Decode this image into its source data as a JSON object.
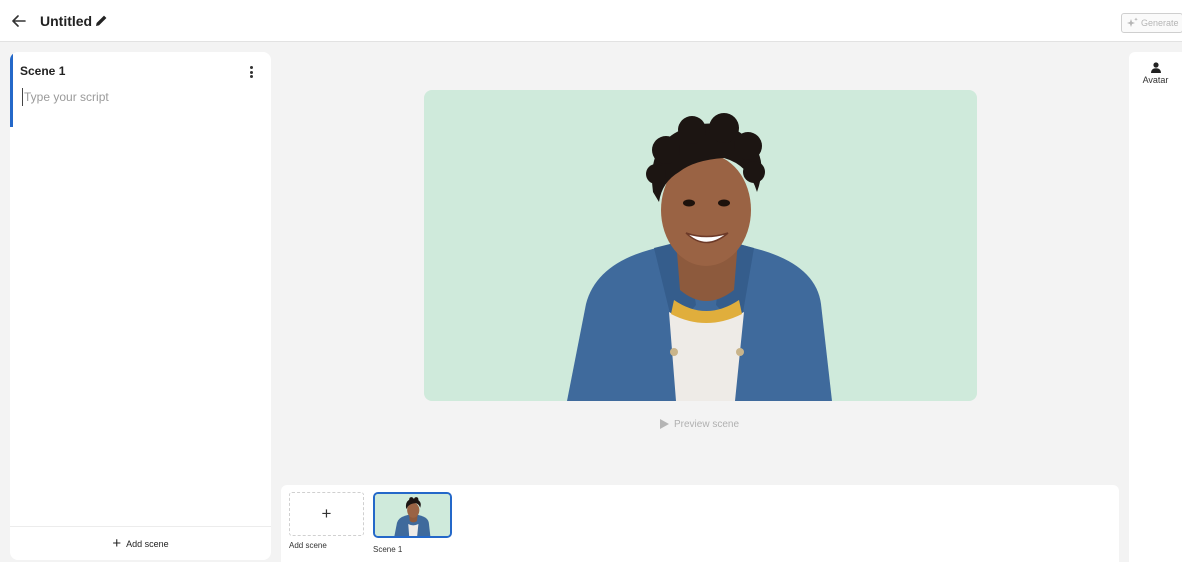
{
  "header": {
    "title": "Untitled",
    "generate_label": "Generate",
    "icons": {
      "back": "arrow-left-icon",
      "edit": "pencil-icon",
      "generate": "sparkle-icon"
    }
  },
  "script_panel": {
    "scene_title": "Scene 1",
    "script_value": "",
    "script_placeholder": "Type your script",
    "add_scene_label": "Add scene",
    "icons": {
      "menu": "more-vertical-icon",
      "add": "plus-icon"
    }
  },
  "canvas": {
    "background_color": "#cfeadb",
    "preview_label": "Preview scene",
    "icons": {
      "preview": "play-icon"
    }
  },
  "timeline": {
    "add_scene_label": "Add scene",
    "scenes": [
      {
        "label": "Scene 1",
        "selected": true
      }
    ]
  },
  "right_rail": {
    "items": [
      {
        "label": "Avatar",
        "icon": "person-icon"
      }
    ]
  },
  "colors": {
    "accent": "#2468c9",
    "canvas_bg": "#cfeadb",
    "app_bg": "#f3f3f3"
  }
}
